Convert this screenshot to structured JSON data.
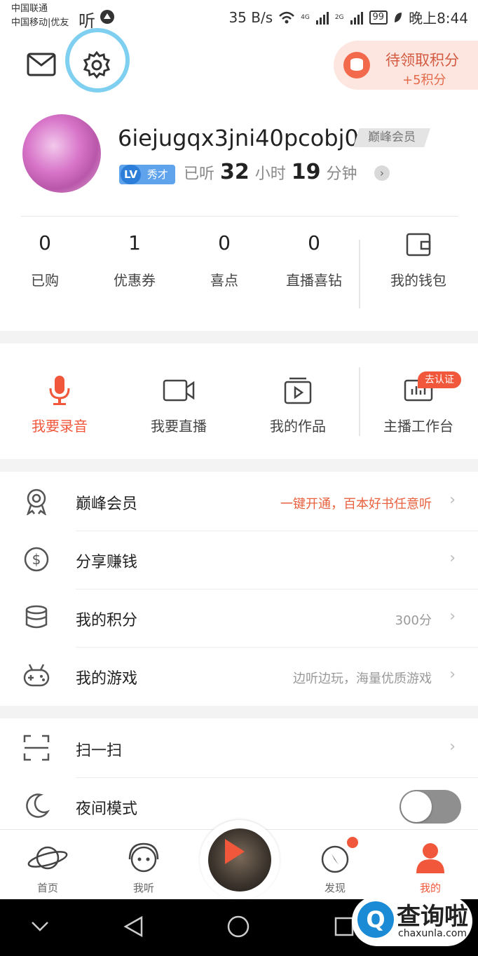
{
  "status_bar": {
    "carrier1": "中国联通",
    "carrier2": "中国移动|优友",
    "app_glyph": "听",
    "speed": "35 B/s",
    "net1": "4G",
    "net2": "2G",
    "battery": "99",
    "time": "晚上8:44"
  },
  "header": {
    "points_title": "待领取积分",
    "points_sub": "+5积分"
  },
  "profile": {
    "username": "6iejugqx3jni40pcobj0",
    "vip_tag": "巅峰会员",
    "lv_label": "LV",
    "lv_title": "秀才",
    "listen_prefix": "已听",
    "hours": "32",
    "hours_unit": "小时",
    "minutes": "19",
    "minutes_unit": "分钟"
  },
  "stats": [
    {
      "value": "0",
      "label": "已购"
    },
    {
      "value": "1",
      "label": "优惠券"
    },
    {
      "value": "0",
      "label": "喜点"
    },
    {
      "value": "0",
      "label": "直播喜钻"
    }
  ],
  "wallet_label": "我的钱包",
  "tools": [
    {
      "label": "我要录音",
      "icon": "microphone-icon"
    },
    {
      "label": "我要直播",
      "icon": "video-camera-icon"
    },
    {
      "label": "我的作品",
      "icon": "play-folder-icon"
    },
    {
      "label": "主播工作台",
      "icon": "studio-monitor-icon",
      "badge": "去认证"
    }
  ],
  "menu": [
    {
      "title": "巅峰会员",
      "right": "一键开通，百本好书任意听",
      "icon": "medal-icon"
    },
    {
      "title": "分享赚钱",
      "right": "",
      "icon": "dollar-icon"
    },
    {
      "title": "我的积分",
      "right": "300分",
      "icon": "coins-stack-icon"
    },
    {
      "title": "我的游戏",
      "right": "边听边玩，海量优质游戏",
      "icon": "gamepad-icon"
    },
    {
      "title": "扫一扫",
      "right": "",
      "icon": "scan-icon"
    },
    {
      "title": "夜间模式",
      "right": "",
      "icon": "moon-icon"
    }
  ],
  "tabs": [
    {
      "label": "首页",
      "icon": "planet-icon"
    },
    {
      "label": "我听",
      "icon": "headphone-face-icon"
    },
    {
      "label": "发现",
      "icon": "compass-icon"
    },
    {
      "label": "我的",
      "icon": "person-icon"
    }
  ],
  "watermark": {
    "glyph": "Q",
    "title": "查询啦",
    "site": "chaxunla.com"
  },
  "colors": {
    "accent": "#f0573b",
    "annotation": "#7fd0f0",
    "vip_text": "#e8613e"
  }
}
